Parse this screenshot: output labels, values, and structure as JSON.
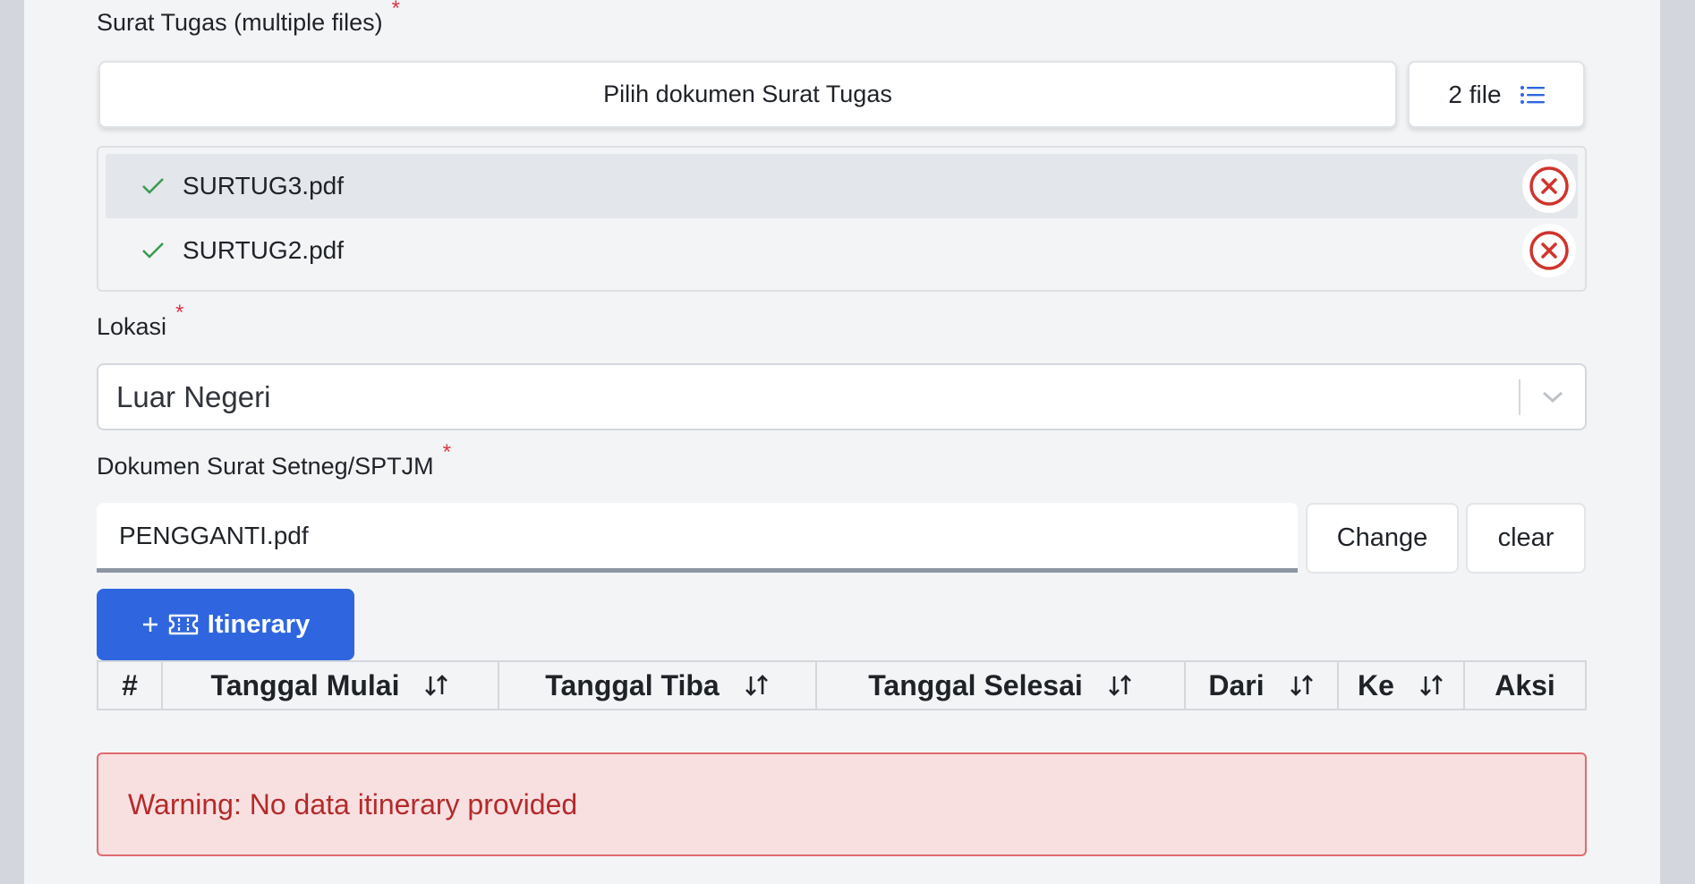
{
  "surat_tugas": {
    "label": "Surat Tugas (multiple files)",
    "required_mark": "*",
    "pick_label": "Pilih dokumen Surat Tugas",
    "count_label": "2 file",
    "files": [
      {
        "name": "SURTUG3.pdf",
        "selected": true
      },
      {
        "name": "SURTUG2.pdf",
        "selected": false
      }
    ]
  },
  "lokasi": {
    "label": "Lokasi",
    "required_mark": "*",
    "value": "Luar Negeri"
  },
  "dokumen_setneg": {
    "label": "Dokumen Surat Setneg/SPTJM",
    "required_mark": "*",
    "file_name": "PENGGANTI.pdf",
    "change_label": "Change",
    "clear_label": "clear"
  },
  "itinerary": {
    "button_label": "Itinerary",
    "columns": [
      "#",
      "Tanggal Mulai",
      "Tanggal Tiba",
      "Tanggal Selesai",
      "Dari",
      "Ke",
      "Aksi"
    ],
    "warning": "Warning: No data itinerary provided"
  },
  "colors": {
    "primary": "#2f66df",
    "required": "#dc3545",
    "success_check": "#3a9a52",
    "remove": "#d0342c",
    "warning_bg": "#f8e0e1",
    "warning_text": "#b52a2a"
  },
  "icons": {
    "list": "list-icon",
    "check": "check-icon",
    "remove": "close-circle-icon",
    "chevron": "chevron-down-icon",
    "plus": "plus-icon",
    "ticket": "ticket-icon",
    "sort": "sort-icon"
  }
}
